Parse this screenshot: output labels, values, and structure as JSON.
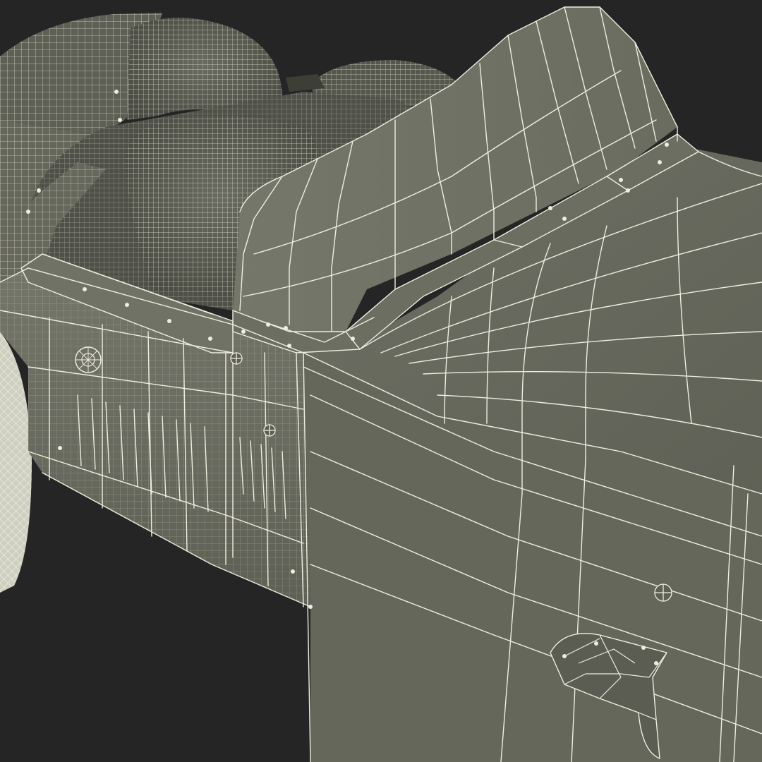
{
  "scene": {
    "colors": {
      "background": "#252525",
      "body_dark": "#5d5f54",
      "body_mid": "#6b6d61",
      "body_light": "#7a7c70",
      "wire": "#efeede",
      "seat": "#55574d",
      "tire": "#cfcfc1"
    }
  }
}
